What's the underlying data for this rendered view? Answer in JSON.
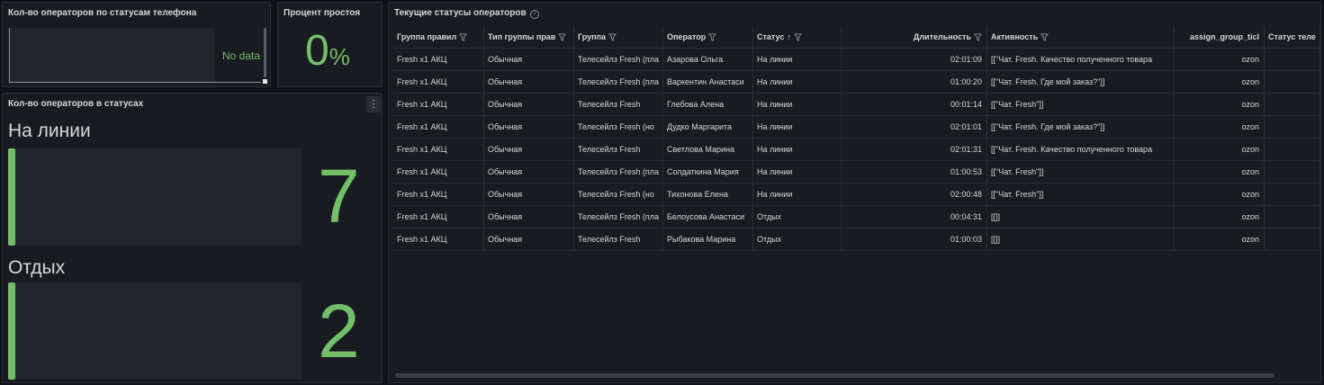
{
  "phone_panel": {
    "title": "Кол-во операторов по статусам телефона",
    "nodata": "No data"
  },
  "idle_panel": {
    "title": "Процент простоя",
    "value": "0",
    "unit": "%"
  },
  "status_panel": {
    "title": "Кол-во операторов в статусах",
    "menu_icon": "⋮",
    "stats": [
      {
        "label": "На линии",
        "value": "7"
      },
      {
        "label": "Отдых",
        "value": "2"
      }
    ],
    "accent": "#73bf69"
  },
  "table_panel": {
    "title": "Текущие статусы операторов",
    "info_icon": "i",
    "columns": [
      "Группа правил",
      "Тип группы прав",
      "Группа",
      "Оператор",
      "Статус",
      "Длительность",
      "Активность",
      "assign_group_ticl",
      "Статус теле"
    ],
    "rows": [
      [
        "Fresh x1 АКЦ",
        "Обычная",
        "Телесейлз Fresh (пла",
        "Азарова Ольга",
        "На линии",
        "02:01:09",
        "[[\"Чат. Fresh. Качество полученного товара",
        "ozon",
        ""
      ],
      [
        "Fresh x1 АКЦ",
        "Обычная",
        "Телесейлз Fresh (пла",
        "Варкентин Анастаси",
        "На линии",
        "01:00:20",
        "[[\"Чат. Fresh. Где мой заказ?\"]]",
        "ozon",
        ""
      ],
      [
        "Fresh x1 АКЦ",
        "Обычная",
        "Телесейлз Fresh",
        "Глебова Алена",
        "На линии",
        "00:01:14",
        "[[\"Чат. Fresh\"]]",
        "ozon",
        ""
      ],
      [
        "Fresh x1 АКЦ",
        "Обычная",
        "Телесейлз Fresh (но",
        "Дудко Маргарита",
        "На линии",
        "02:01:01",
        "[[\"Чат. Fresh. Где мой заказ?\"]]",
        "ozon",
        ""
      ],
      [
        "Fresh x1 АКЦ",
        "Обычная",
        "Телесейлз Fresh",
        "Светлова Марина",
        "На линии",
        "02:01:31",
        "[[\"Чат. Fresh. Качество полученного товара",
        "ozon",
        ""
      ],
      [
        "Fresh x1 АКЦ",
        "Обычная",
        "Телесейлз Fresh (пла",
        "Солдаткина Мария",
        "На линии",
        "01:00:53",
        "[[\"Чат. Fresh\"]]",
        "ozon",
        ""
      ],
      [
        "Fresh x1 АКЦ",
        "Обычная",
        "Телесейлз Fresh (но",
        "Тихонова Елена",
        "На линии",
        "02:00:48",
        "[[\"Чат. Fresh\"]]",
        "ozon",
        ""
      ],
      [
        "Fresh x1 АКЦ",
        "Обычная",
        "Телесейлз Fresh (пла",
        "Белоусова Анастаси",
        "Отдых",
        "00:04:31",
        "[[]]",
        "ozon",
        ""
      ],
      [
        "Fresh x1 АКЦ",
        "Обычная",
        "Телесейлз Fresh",
        "Рыбакова Марина",
        "Отдых",
        "01:00:03",
        "[[]]",
        "ozon",
        ""
      ]
    ],
    "sort_arrow": "↑"
  }
}
